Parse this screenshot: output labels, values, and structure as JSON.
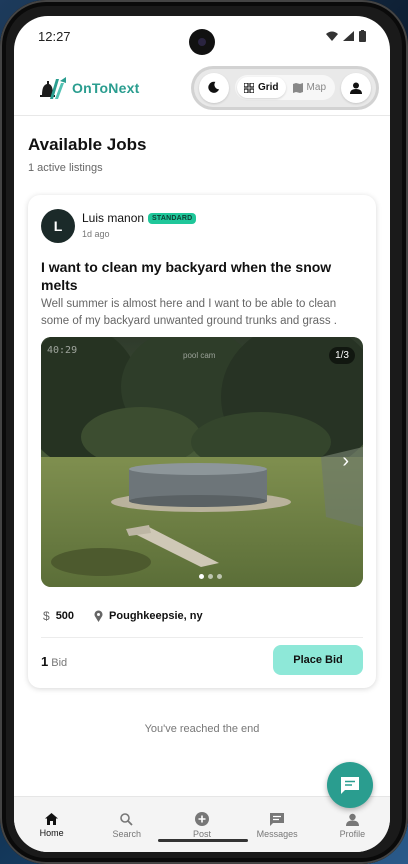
{
  "status": {
    "time": "12:27"
  },
  "header": {
    "brand": "OnToNext",
    "view_toggle": [
      {
        "label": "Grid",
        "icon": "grid-icon",
        "active": true
      },
      {
        "label": "Map",
        "icon": "map-icon",
        "active": false
      }
    ]
  },
  "main": {
    "title": "Available Jobs",
    "subtitle": "1 active listings",
    "end_message": "You've reached the end"
  },
  "job": {
    "author_initial": "L",
    "author_name": "Luis manon",
    "badge": "STANDARD",
    "time_ago": "1d ago",
    "title": "I want to clean my backyard when the snow melts",
    "description": "Well summer is almost here and I want to be able to clean some of my backyard unwanted ground trunks and grass .",
    "photo_counter": "1/3",
    "photo_timestamp": "40:29",
    "photo_watermark": "pool cam",
    "price_value": "500",
    "location": "Poughkeepsie, ny",
    "bid_count": "1",
    "bid_label": "Bid",
    "place_bid_label": "Place Bid"
  },
  "nav": {
    "items": [
      {
        "label": "Home",
        "icon": "home-icon",
        "active": true
      },
      {
        "label": "Search",
        "icon": "search-icon",
        "active": false
      },
      {
        "label": "Post",
        "icon": "add-circle-icon",
        "active": false
      },
      {
        "label": "Messages",
        "icon": "message-icon",
        "active": false
      },
      {
        "label": "Profile",
        "icon": "profile-icon",
        "active": false
      }
    ]
  },
  "colors": {
    "accent": "#2a9d8f",
    "badge": "#1fc79a",
    "place_bid_bg": "#8ee8d8"
  }
}
